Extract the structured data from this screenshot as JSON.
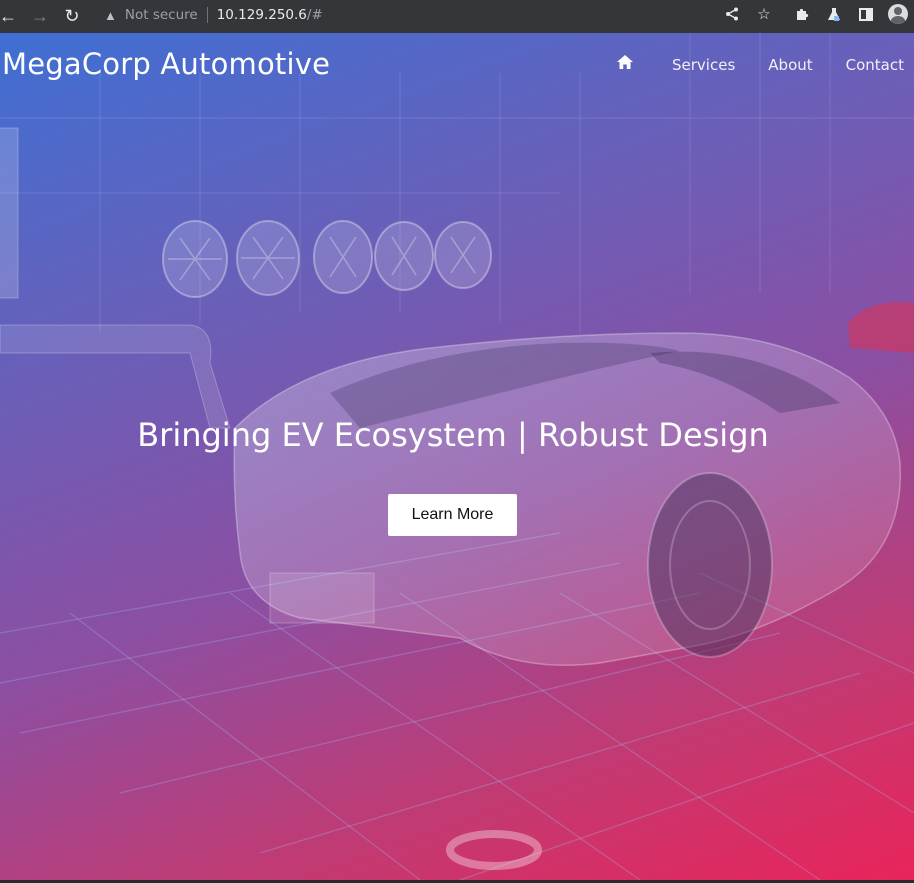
{
  "browser": {
    "security_label": "Not secure",
    "url_host": "10.129.250.6",
    "url_path": "/#"
  },
  "site": {
    "brand": "MegaCorp Automotive",
    "nav": [
      {
        "label": "Services"
      },
      {
        "label": "About"
      },
      {
        "label": "Contact"
      }
    ],
    "hero": {
      "headline": "Bringing EV Ecosystem | Robust Design",
      "cta_label": "Learn More"
    }
  },
  "icons": {
    "home": "home-icon",
    "back": "back-arrow-icon",
    "forward": "forward-arrow-icon",
    "reload": "reload-icon",
    "share": "share-icon",
    "bookmark": "star-icon",
    "extensions": "puzzle-icon",
    "labs": "flask-icon",
    "sidepanel": "side-panel-icon",
    "profile": "profile-avatar-icon"
  },
  "colors": {
    "gradient_start": "#3f6fd4",
    "gradient_end": "#e8245a",
    "chrome_bg": "#35363a"
  }
}
